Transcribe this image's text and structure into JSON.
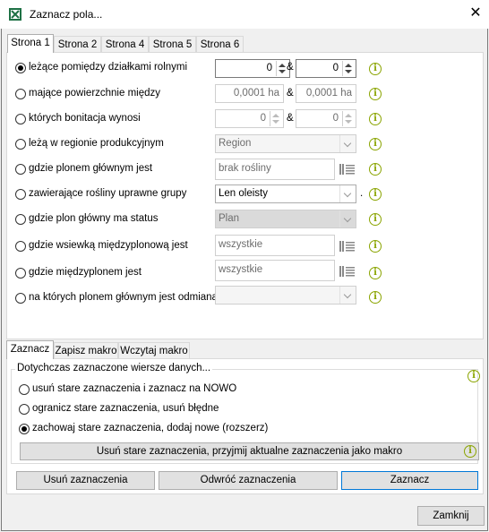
{
  "window": {
    "title": "Zaznacz pola...",
    "close_glyph": "✕",
    "app_icon": "excel-icon"
  },
  "top_tabs": [
    {
      "label": "Strona 1",
      "active": true
    },
    {
      "label": "Strona 2",
      "active": false
    },
    {
      "label": "Strona 4",
      "active": false
    },
    {
      "label": "Strona 5",
      "active": false
    },
    {
      "label": "Strona 6",
      "active": false
    }
  ],
  "criteria": {
    "row1": {
      "label": "leżące pomiędzy działkami rolnymi",
      "selected": true,
      "from": "0",
      "to": "0",
      "amp": "&"
    },
    "row2": {
      "label": "mające powierzchnie między",
      "from": "0,0001 ha",
      "to": "0,0001 ha",
      "amp": "&"
    },
    "row3": {
      "label": "których bonitacja wynosi",
      "from": "0",
      "to": "0",
      "amp": "&"
    },
    "row4": {
      "label": "leżą w regionie produkcyjnym",
      "value": "Region"
    },
    "row5": {
      "label": "gdzie plonem głównym jest",
      "value": "brak rośliny"
    },
    "row6": {
      "label": "zawierające rośliny uprawne grupy",
      "value": "Len oleisty",
      "suffix": "."
    },
    "row7": {
      "label": "gdzie plon główny ma status",
      "value": "Plan"
    },
    "row8": {
      "label": "gdzie wsiewką międzyplonową jest",
      "value": "wszystkie"
    },
    "row9": {
      "label": "gdzie międzyplonem jest",
      "value": "wszystkie"
    },
    "row10": {
      "label": "na których plonem głównym jest odmiana",
      "value": ""
    }
  },
  "bottom_tabs": [
    {
      "label": "Zaznacz",
      "active": true
    },
    {
      "label": "Zapisz makro",
      "active": false
    },
    {
      "label": "Wczytaj makro",
      "active": false
    }
  ],
  "selection_group": {
    "caption": "Dotychczas zaznaczone wiersze danych...",
    "options": [
      {
        "label": "usuń stare zaznaczenia i zaznacz na NOWO",
        "selected": false
      },
      {
        "label": "ogranicz stare zaznaczenia, usuń błędne",
        "selected": false
      },
      {
        "label": "zachowaj stare zaznaczenia, dodaj nowe (rozszerz)",
        "selected": true
      }
    ],
    "macro_button": "Usuń stare zaznaczenia, przyjmij aktualne zaznaczenia jako makro"
  },
  "actions": {
    "clear": "Usuń zaznaczenia",
    "invert": "Odwróć zaznaczenia",
    "select": "Zaznacz"
  },
  "footer": {
    "close": "Zamknij"
  },
  "info_glyph": "i",
  "colors": {
    "info": "#8aa400",
    "default_button_border": "#0078d7"
  }
}
